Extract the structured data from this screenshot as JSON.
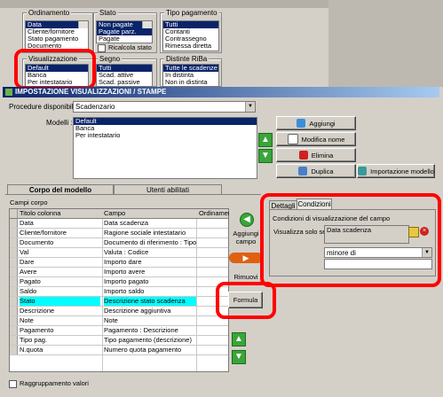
{
  "background_panel": {
    "ordinamento": {
      "title": "Ordinamento",
      "items": [
        "Data",
        "Cliente/fornitore",
        "Stato pagamento",
        "Documento"
      ],
      "selected": 0
    },
    "stato": {
      "title": "Stato",
      "items": [
        "Non pagate",
        "Pagate parz.",
        "Pagate"
      ],
      "selected": [
        0,
        1
      ],
      "checkbox_label": "Ricalcola stato"
    },
    "tipo_pagamento": {
      "title": "Tipo pagamento",
      "items": [
        "Tutti",
        "Contanti",
        "Contrassegno",
        "Rimessa diretta"
      ],
      "selected": 0
    },
    "visualizzazione": {
      "title": "Visualizzazione",
      "items": [
        "Default",
        "Banca",
        "Per intestatario"
      ],
      "selected": 0
    },
    "segno": {
      "title": "Segno",
      "items": [
        "Tutti",
        "Scad. attive",
        "Scad. passive"
      ],
      "selected": 0
    },
    "distinte_riba": {
      "title": "Distinte RiBa",
      "items": [
        "Tutte le scadenze",
        "In distinta",
        "Non in distinta"
      ],
      "selected": 0
    }
  },
  "dialog": {
    "title": "IMPOSTAZIONE VISUALIZZAZIONI / STAMPE",
    "procedure_label": "Procedure disponibili :",
    "procedure_value": "Scadenzario",
    "modelli_label": "Modelli :",
    "modelli": [
      "Default",
      "Banca",
      "Per intestatario"
    ],
    "modelli_selected": 0,
    "buttons": {
      "aggiungi": "Aggiungi",
      "modifica_nome": "Modifica nome",
      "elimina": "Elimina",
      "duplica": "Duplica",
      "importazione_modello": "Importazione modello"
    },
    "tabs": [
      "Corpo del modello",
      "Utenti abilitati"
    ],
    "campi_label": "Campi corpo",
    "grid_headers": [
      "Titolo colonna",
      "Campo",
      "Ordinamento"
    ],
    "rows": [
      {
        "titolo": "Data",
        "campo": "Data scadenza"
      },
      {
        "titolo": "Cliente/fornitore",
        "campo": "Ragione sociale intestatario"
      },
      {
        "titolo": "Documento",
        "campo": "Documento di riferimento : Tipo,..."
      },
      {
        "titolo": "Val",
        "campo": "Valuta : Codice"
      },
      {
        "titolo": "Dare",
        "campo": "Importo dare"
      },
      {
        "titolo": "Avere",
        "campo": "Importo avere"
      },
      {
        "titolo": "Pagato",
        "campo": "Importo pagato"
      },
      {
        "titolo": "Saldo",
        "campo": "Importo saldo"
      },
      {
        "titolo": "Stato",
        "campo": "Descrizione stato scadenza"
      },
      {
        "titolo": "Descrizione",
        "campo": "Descrizione aggiuntiva"
      },
      {
        "titolo": "Note",
        "campo": "Note"
      },
      {
        "titolo": "Pagamento",
        "campo": "Pagamento : Descrizione"
      },
      {
        "titolo": "Tipo pag.",
        "campo": "Tipo pagamento (descrizione)"
      },
      {
        "titolo": "N.quota",
        "campo": "Numero quota pagamento"
      }
    ],
    "current_row": 8,
    "side_buttons": {
      "aggiungi_campo": "Aggiungi campo",
      "rimuovi": "Rimuovi",
      "formula": "Formula"
    },
    "right_tabs": [
      "Dettagli",
      "Condizioni"
    ],
    "condizioni": {
      "group_title": "Condizioni di visualizzazione del campo",
      "visualizza_label": "Visualizza solo se :",
      "field_value": "Data scadenza",
      "operator": "minore di",
      "value": ""
    },
    "raggruppamento_label": "Raggruppamento valori"
  },
  "colors": {
    "selection": "#0a246a",
    "highlight": "#00ffff",
    "annotation": "#ff0000"
  }
}
